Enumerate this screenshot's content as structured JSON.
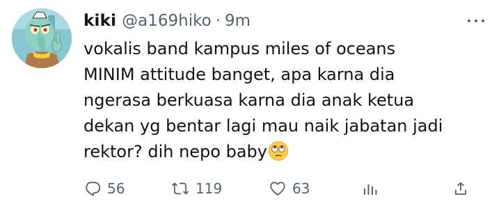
{
  "tweet": {
    "display_name": "kiki",
    "handle": "@a169hiko",
    "separator": "·",
    "time": "9m",
    "text_lines": [
      "vokalis band kampus miles of oceans",
      "MINIM attitude banget, apa karna dia",
      "ngerasa berkuasa karna dia anak ketua",
      "dekan yg bentar lagi mau naik jabatan jadi",
      "rektor? dih nepo baby"
    ],
    "emoji": "face-with-rolling-eyes-emoji"
  },
  "actions": {
    "reply": {
      "icon": "reply-icon",
      "count": "56"
    },
    "retweet": {
      "icon": "retweet-icon",
      "count": "119"
    },
    "like": {
      "icon": "heart-icon",
      "count": "63"
    },
    "views": {
      "icon": "analytics-icon"
    },
    "share": {
      "icon": "share-icon"
    }
  },
  "colors": {
    "text": "#0f1419",
    "secondary": "#536471",
    "background": "#ffffff"
  }
}
